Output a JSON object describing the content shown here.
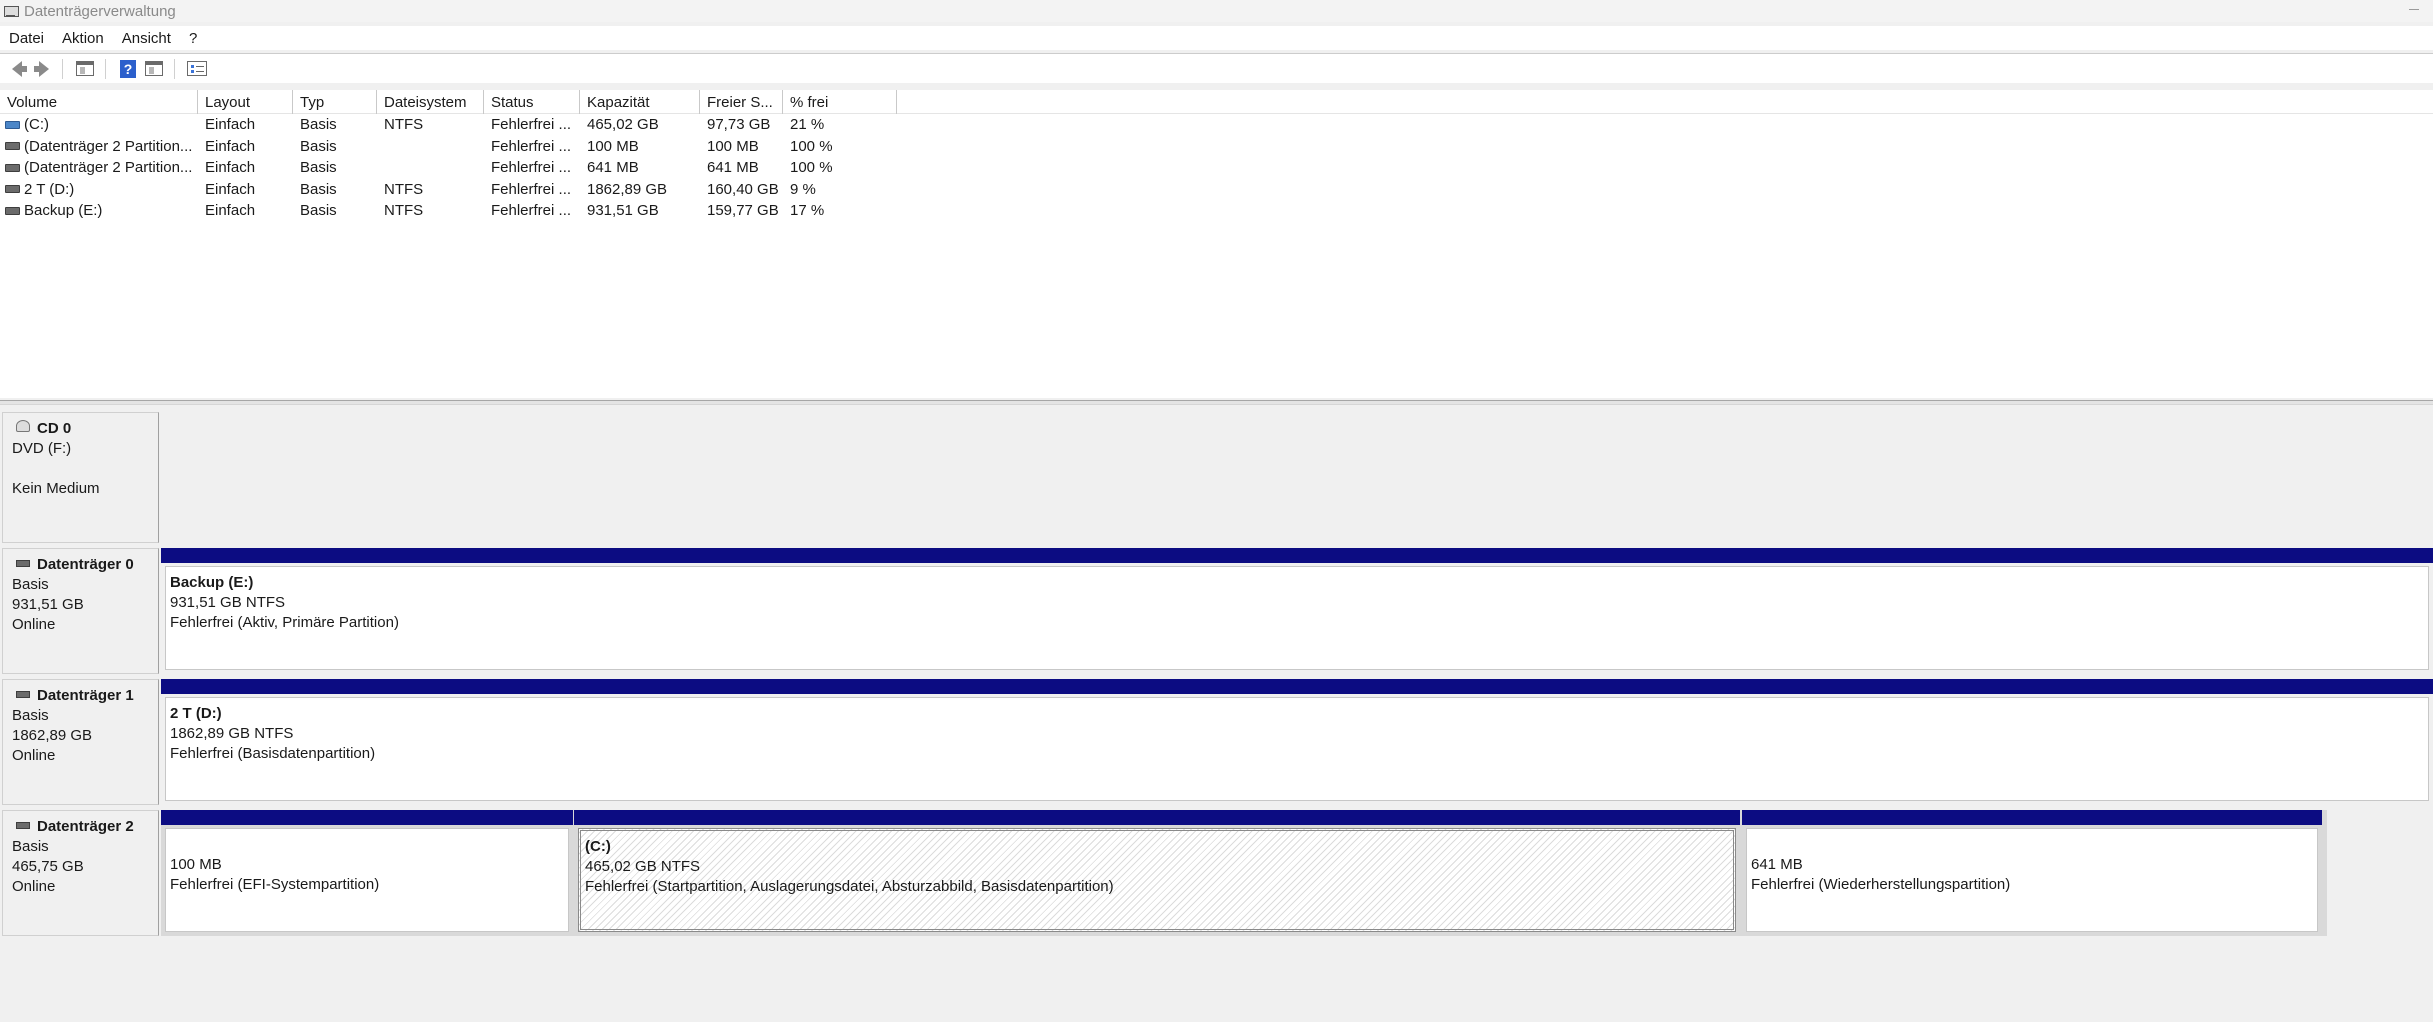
{
  "window": {
    "title": "Datenträgerverwaltung"
  },
  "menu": [
    "Datei",
    "Aktion",
    "Ansicht",
    "?"
  ],
  "toolbar": {
    "icons": [
      "back-icon",
      "forward-icon",
      "console-tree-icon",
      "help-icon",
      "show-hide-pane-icon",
      "properties-icon"
    ]
  },
  "volume_list": {
    "columns": [
      "Volume",
      "Layout",
      "Typ",
      "Dateisystem",
      "Status",
      "Kapazität",
      "Freier S...",
      "% frei"
    ],
    "rows": [
      {
        "icon": "system-volume-icon",
        "cells": [
          "(C:)",
          "Einfach",
          "Basis",
          "NTFS",
          "Fehlerfrei ...",
          "465,02 GB",
          "97,73 GB",
          "21 %"
        ]
      },
      {
        "icon": "volume-icon",
        "cells": [
          "(Datenträger 2 Partition...",
          "Einfach",
          "Basis",
          "",
          "Fehlerfrei ...",
          "100 MB",
          "100 MB",
          "100 %"
        ]
      },
      {
        "icon": "volume-icon",
        "cells": [
          "(Datenträger 2 Partition...",
          "Einfach",
          "Basis",
          "",
          "Fehlerfrei ...",
          "641 MB",
          "641 MB",
          "100 %"
        ]
      },
      {
        "icon": "volume-icon",
        "cells": [
          "2 T (D:)",
          "Einfach",
          "Basis",
          "NTFS",
          "Fehlerfrei ...",
          "1862,89 GB",
          "160,40 GB",
          "9 %"
        ]
      },
      {
        "icon": "volume-icon",
        "cells": [
          "Backup (E:)",
          "Einfach",
          "Basis",
          "NTFS",
          "Fehlerfrei ...",
          "931,51 GB",
          "159,77 GB",
          "17 %"
        ]
      }
    ]
  },
  "disks": {
    "cd0": {
      "name": "CD 0",
      "line1": "DVD (F:)",
      "line2": "",
      "line3": "Kein Medium"
    },
    "disk0": {
      "name": "Datenträger 0",
      "type": "Basis",
      "size": "931,51 GB",
      "state": "Online",
      "partitions": [
        {
          "title": "Backup  (E:)",
          "size": "931,51 GB NTFS",
          "status": "Fehlerfrei (Aktiv, Primäre Partition)"
        }
      ]
    },
    "disk1": {
      "name": "Datenträger 1",
      "type": "Basis",
      "size": "1862,89 GB",
      "state": "Online",
      "partitions": [
        {
          "title": "2 T  (D:)",
          "size": "1862,89 GB NTFS",
          "status": "Fehlerfrei (Basisdatenpartition)"
        }
      ]
    },
    "disk2": {
      "name": "Datenträger 2",
      "type": "Basis",
      "size": "465,75 GB",
      "state": "Online",
      "partitions": [
        {
          "title": "",
          "size": "100 MB",
          "status": "Fehlerfrei (EFI-Systempartition)"
        },
        {
          "title": "(C:)",
          "size": "465,02 GB NTFS",
          "status": "Fehlerfrei (Startpartition, Auslagerungsdatei, Absturzabbild, Basisdatenpartition)"
        },
        {
          "title": "",
          "size": "641 MB",
          "status": "Fehlerfrei (Wiederherstellungspartition)"
        }
      ]
    }
  },
  "colors": {
    "partition_bar": "#0c0c82",
    "list_background": "#ffffff",
    "panel_background": "#f0f0f0"
  }
}
